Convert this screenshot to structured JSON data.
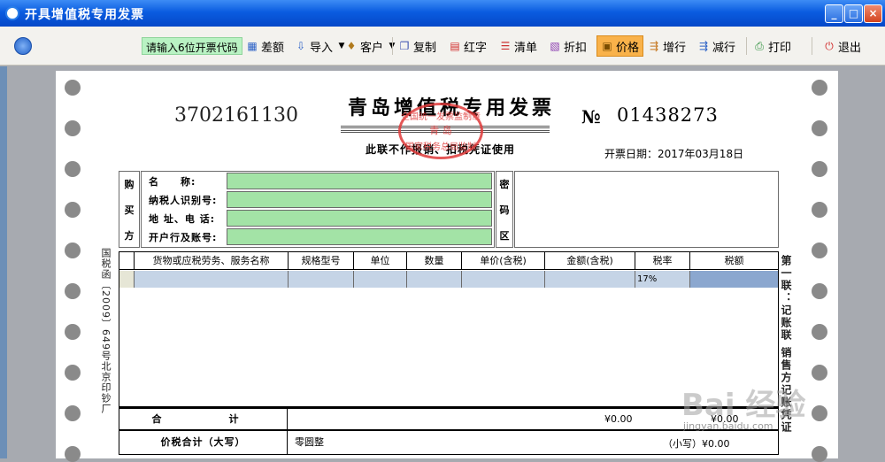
{
  "window": {
    "title": "开具增值税专用发票",
    "min_label": "_",
    "max_label": "□",
    "close_label": "×"
  },
  "toolbar": {
    "code_field": "请输入6位开票代码",
    "buttons": [
      {
        "label": "差额",
        "icon": "grid-icon"
      },
      {
        "label": "导入",
        "icon": "import-icon"
      },
      {
        "label": "客户",
        "icon": "customer-icon"
      },
      {
        "label": "复制",
        "icon": "copy-icon"
      },
      {
        "label": "红字",
        "icon": "red-invoice-icon"
      },
      {
        "label": "清单",
        "icon": "list-icon"
      },
      {
        "label": "折扣",
        "icon": "discount-icon"
      },
      {
        "label": "价格",
        "icon": "price-icon"
      },
      {
        "label": "增行",
        "icon": "add-row-icon"
      },
      {
        "label": "减行",
        "icon": "remove-row-icon"
      },
      {
        "label": "打印",
        "icon": "print-icon"
      },
      {
        "label": "退出",
        "icon": "exit-icon"
      }
    ]
  },
  "invoice": {
    "code": "3702161130",
    "title": "青岛增值税专用发票",
    "subtitle": "此联不作报销、扣税凭证使用",
    "seal": {
      "top": "全国统一发票监制章",
      "center": "青 岛",
      "bottom": "国家税务总局监制"
    },
    "no_symbol": "№",
    "number": "01438273",
    "date": "开票日期：2017年03月18日",
    "left_margin_text": "国税函〔2009〕649号北京印钞厂",
    "right_margin_text": "第一联：记账联 销售方记账凭证",
    "buyer": {
      "side_label": [
        "购",
        "买",
        "方"
      ],
      "fields": [
        {
          "label": "名　　称:",
          "value": ""
        },
        {
          "label": "纳税人识别号:",
          "value": ""
        },
        {
          "label": "地 址、电 话:",
          "value": ""
        },
        {
          "label": "开户行及账号:",
          "value": ""
        }
      ]
    },
    "cipher": {
      "side_label": [
        "密",
        "码",
        "区"
      ]
    },
    "items": {
      "headers": [
        "货物或应税劳务、服务名称",
        "规格型号",
        "单位",
        "数量",
        "单价(含税)",
        "金额(含税)",
        "税率",
        "税额"
      ],
      "rows": [
        {
          "name": "",
          "spec": "",
          "unit": "",
          "qty": "",
          "price": "",
          "amount": "",
          "rate": "17%",
          "tax": ""
        }
      ]
    },
    "total": {
      "label": "合　　计",
      "amount": "¥0.00",
      "tax": "¥0.00"
    },
    "capital": {
      "label": "价税合计（大写）",
      "value": "零圆整",
      "small": "（小写）¥0.00"
    }
  },
  "watermark": {
    "main": "Bai 经验",
    "sub": "jingyan.baidu.com"
  }
}
